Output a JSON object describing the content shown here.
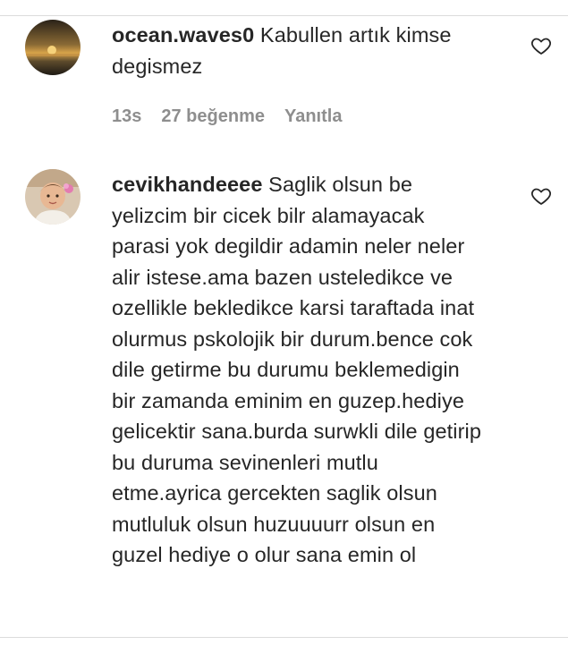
{
  "comments": [
    {
      "username": "ocean.waves0",
      "text": "Kabullen artık kimse degismez",
      "time": "13s",
      "likes": "27 beğenme",
      "reply": "Yanıtla",
      "avatar_icon": "sunset-avatar-icon",
      "like_icon": "heart-outline-icon"
    },
    {
      "username": "cevikhandeeee",
      "text": "Saglik olsun be yelizcim bir cicek bilr alamayacak parasi yok degildir adamin neler neler alir istese.ama bazen usteledikce ve ozellikle bekledikce karsi taraftada inat olurmus pskolojik bir durum.bence cok dile getirme bu durumu beklemedigin bir zamanda eminim en guzep.hediye gelicektir sana.burda surwkli dile getirip bu duruma sevinenleri mutlu etme.ayrica gercekten saglik olsun mutluluk olsun huzuuuurr olsun en guzel hediye o olur sana emin ol",
      "avatar_icon": "child-photo-avatar-icon",
      "like_icon": "heart-outline-icon"
    }
  ]
}
